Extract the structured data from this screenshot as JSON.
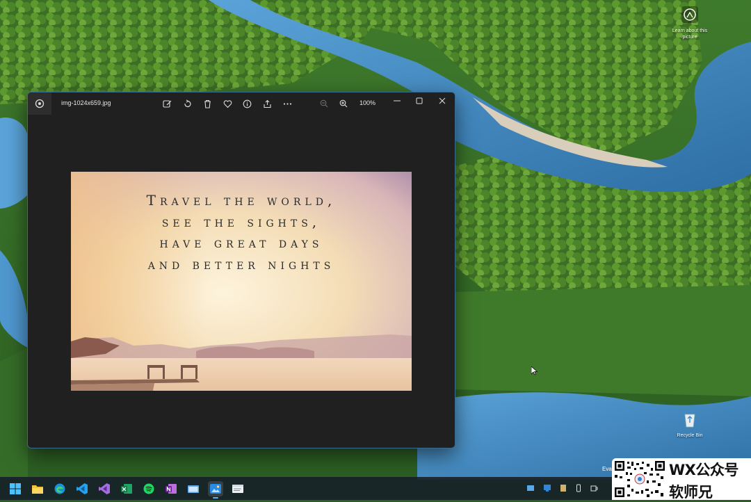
{
  "desktop": {
    "learn_icon": {
      "label": "Learn about this picture",
      "icon": "info-circle-icon"
    },
    "recycle_bin": {
      "label": "Recycle Bin",
      "icon": "recycle-bin-icon"
    },
    "corner_text": "Eva"
  },
  "photos_window": {
    "filename": "img-1024x659.jpg",
    "toolbar_icons": [
      "edit-icon",
      "rotate-icon",
      "delete-icon",
      "favorite-icon",
      "info-icon",
      "share-icon",
      "more-icon"
    ],
    "zoom_out_icon": "zoom-out-icon",
    "zoom_in_icon": "zoom-in-icon",
    "zoom_level": "100%",
    "caption_buttons": [
      "minimize-icon",
      "maximize-icon",
      "close-icon"
    ],
    "image_quote": {
      "line1": "Travel the world,",
      "line2": "see the sights,",
      "line3": "have great days",
      "line4": "and better nights"
    }
  },
  "taskbar": {
    "apps": [
      "start-icon",
      "file-explorer-icon",
      "edge-icon",
      "vscode-icon",
      "visual-studio-icon",
      "excel-icon",
      "spotify-icon",
      "onenote-icon",
      "explorer-window-icon",
      "photos-icon",
      "notepad-icon"
    ],
    "active_app": "photos-icon"
  },
  "watermark": {
    "line1": "WX公众号",
    "line2": "软师兄"
  },
  "colors": {
    "window_bg": "#202020",
    "accent": "#5fb2f2",
    "quote_text": "#2c2c2c"
  }
}
